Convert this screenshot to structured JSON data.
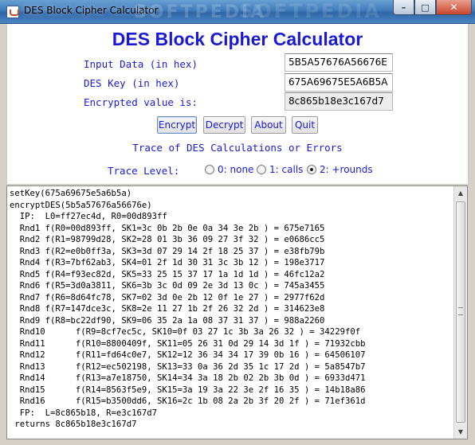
{
  "window": {
    "title": "DES Block Cipher Calculator",
    "watermark": "SOFTPEDIA",
    "controls": {
      "minimize": "–",
      "maximize": "□",
      "close": "✕"
    }
  },
  "heading": "DES Block Cipher Calculator",
  "form": {
    "input_label": "Input Data (in hex)",
    "input_value": "5B5A57676A56676E",
    "key_label": "DES Key (in hex)",
    "key_value": "675A69675E5A6B5A",
    "result_label": "Encrypted value is:",
    "result_value": "8c865b18e3c167d7"
  },
  "buttons": {
    "encrypt": "Encrypt",
    "decrypt": "Decrypt",
    "about": "About",
    "quit": "Quit"
  },
  "trace_heading": "Trace of DES Calculations or Errors",
  "trace_level": {
    "label": "Trace Level:",
    "options": [
      "0: none",
      "1: calls",
      "2: +rounds"
    ],
    "selected": "2: +rounds"
  },
  "trace_lines": [
    "setKey(675a69675e5a6b5a)",
    "encryptDES(5b5a57676a56676e)",
    "  IP:  L0=ff27ec4d, R0=00d893ff",
    "  Rnd1 f(R0=00d893ff, SK1=3c 0b 2b 0e 0a 34 3e 2b ) = 675e7165",
    "  Rnd2 f(R1=98799d28, SK2=28 01 3b 36 09 27 3f 32 ) = e0686cc5",
    "  Rnd3 f(R2=e0b0ff3a, SK3=3d 07 29 14 2f 18 25 37 ) = e38fb79b",
    "  Rnd4 f(R3=7bf62ab3, SK4=01 2f 1d 30 31 3c 3b 12 ) = 198e3717",
    "  Rnd5 f(R4=f93ec82d, SK5=33 25 15 37 17 1a 1d 1d ) = 46fc12a2",
    "  Rnd6 f(R5=3d0a3811, SK6=3b 3c 0d 09 2e 3d 13 0c ) = 745a3455",
    "  Rnd7 f(R6=8d64fc78, SK7=02 3d 0e 2b 12 0f 1e 27 ) = 2977f62d",
    "  Rnd8 f(R7=147dce3c, SK8=2e 11 27 1b 2f 26 32 2d ) = 314623e8",
    "  Rnd9 f(R8=bc22df90, SK9=06 35 2a 1a 08 37 31 37 ) = 988a2260",
    "  Rnd10      f(R9=8cf7ec5c, SK10=0f 03 27 1c 3b 3a 26 32 ) = 34229f0f",
    "  Rnd11      f(R10=8800409f, SK11=05 26 31 0d 29 14 3d 1f ) = 71932cbb",
    "  Rnd12      f(R11=fd64c0e7, SK12=12 36 34 34 17 39 0b 16 ) = 64506107",
    "  Rnd13      f(R12=ec502198, SK13=33 0a 36 2d 35 1c 17 2d ) = 5a8547b7",
    "  Rnd14      f(R13=a7e18750, SK14=34 3a 18 2b 02 2b 3b 0d ) = 6933d471",
    "  Rnd15      f(R14=8563f5e9, SK15=3a 19 3a 22 3e 2f 16 35 ) = 14b18a86",
    "  Rnd16      f(R15=b3500dd6, SK16=2c 1b 08 2a 2b 3f 20 2f ) = 71ef361d",
    "  FP:  L=8c865b18, R=e3c167d7",
    " returns 8c865b18e3c167d7"
  ]
}
